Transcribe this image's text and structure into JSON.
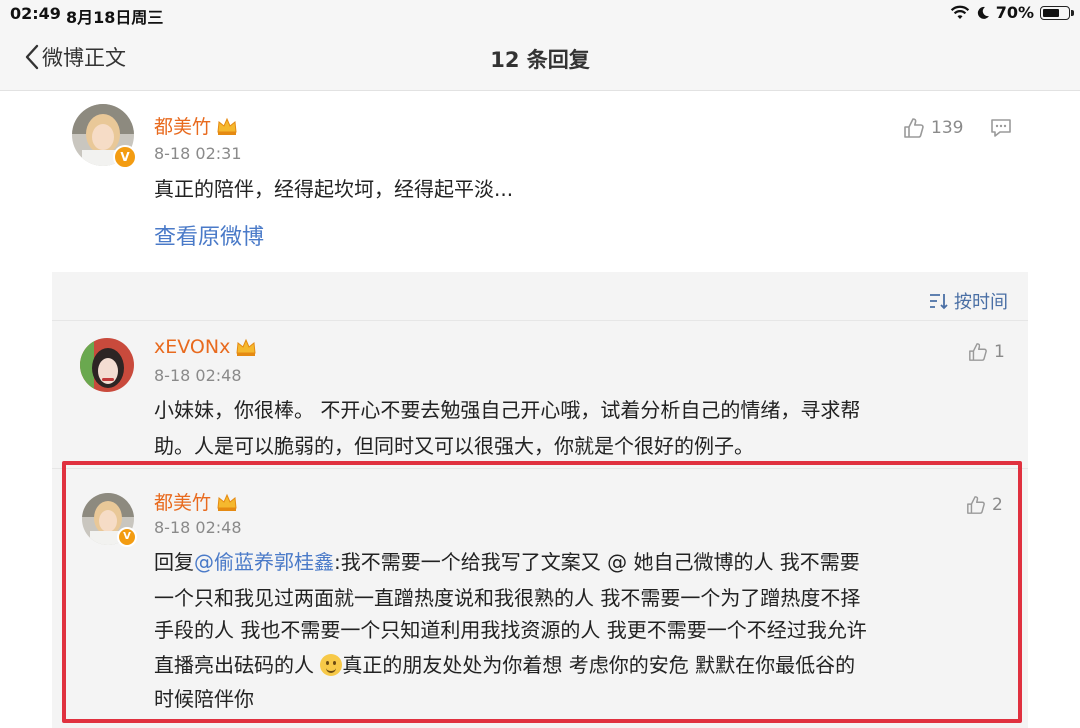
{
  "status_bar": {
    "time": "02:49",
    "date": "8月18日周三",
    "battery": "70%",
    "battery_level": 0.7
  },
  "nav": {
    "back_label": "微博正文",
    "title": "12 条回复"
  },
  "main_comment": {
    "username": "都美竹",
    "timestamp": "8-18 02:31",
    "likes": "139",
    "text": "真正的陪伴，经得起坎坷，经得起平淡...",
    "view_original": "查看原微博"
  },
  "sort": {
    "label": "按时间"
  },
  "replies": [
    {
      "username": "xEVONx",
      "timestamp": "8-18 02:48",
      "likes": "1",
      "text_line1": "小妹妹，你很棒。 不开心不要去勉强自己开心哦，试着分析自己的情绪，寻求帮",
      "text_line2": "助。人是可以脆弱的，但同时又可以很强大，你就是个很好的例子。"
    },
    {
      "username": "都美竹",
      "timestamp": "8-18 02:48",
      "likes": "2",
      "reply_prefix": "回复",
      "mention": "@偷蓝养郭桂鑫",
      "line1_rest": ":我不需要一个给我写了文案又 @ 她自己微博的人 我不需要",
      "line2": "一个只和我见过两面就一直蹭热度说和我很熟的人 我不需要一个为了蹭热度不择",
      "line3": "手段的人 我也不需要一个只知道利用我找资源的人 我更不需要一个不经过我允许",
      "line4_a": "直播亮出砝码的人 ",
      "line4_b": "真正的朋友处处为你着想 考虑你的安危 默默在你最低谷的",
      "line5": "时候陪伴你"
    }
  ],
  "colors": {
    "username": "#e86a1e",
    "link": "#4a7ac8",
    "highlight_border": "#e0313f",
    "reply_bg": "#f4f4f4"
  }
}
